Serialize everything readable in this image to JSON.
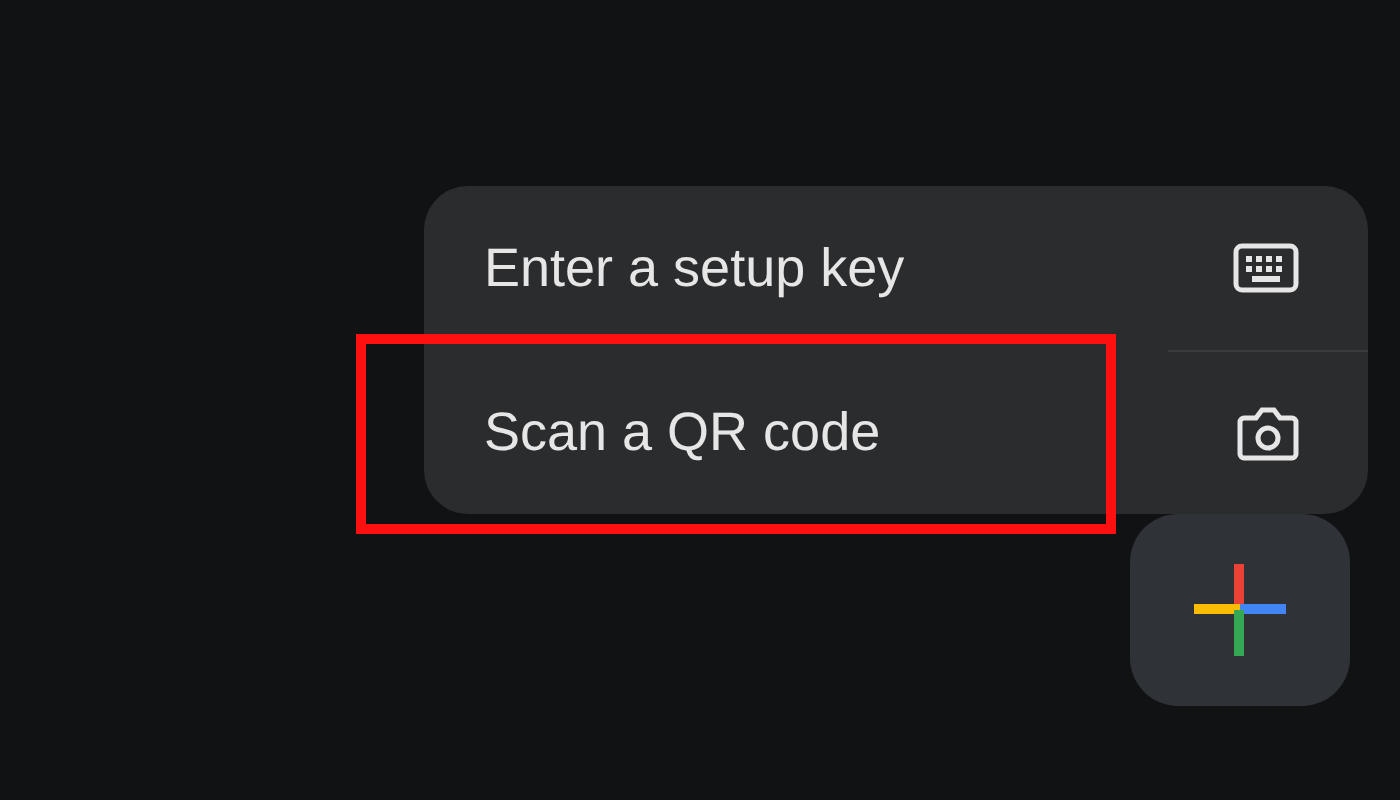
{
  "menu": {
    "items": [
      {
        "label": "Enter a setup key",
        "kind": "keyboard",
        "highlighted": false
      },
      {
        "label": "Scan a QR code",
        "kind": "camera",
        "highlighted": true
      }
    ]
  },
  "fab": {
    "kind": "add"
  }
}
